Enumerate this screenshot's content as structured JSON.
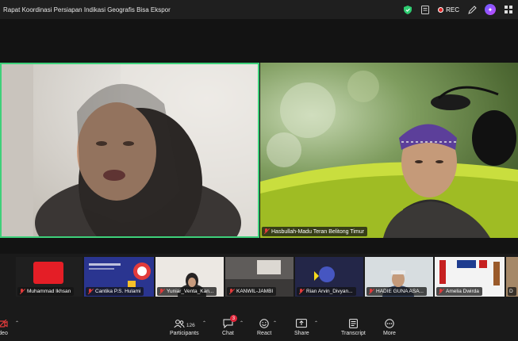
{
  "window": {
    "title": "Rapat Koordinasi Persiapan Indikasi Geografis Bisa Ekspor",
    "rec_label": "REC"
  },
  "main_tiles": [
    {
      "participant": ""
    },
    {
      "participant": "Hasbullah-Madu Teran Belitong Timur"
    }
  ],
  "thumbnails": [
    {
      "name": ""
    },
    {
      "name": "Muhammad Ikhsan"
    },
    {
      "name": "Cantika P.S. Hulami"
    },
    {
      "name": "Yuniar_Venta_Kan..."
    },
    {
      "name": "KANWIL-JAMBI"
    },
    {
      "name": "Rian Arvin_Divyan..."
    },
    {
      "name": "HADIE GUNA ASA..."
    },
    {
      "name": "Amelia Dwirda"
    },
    {
      "name": "D"
    }
  ],
  "toolbar": {
    "video_label": "deo",
    "participants_label": "Participants",
    "participants_count": "126",
    "chat_label": "Chat",
    "chat_badge": "3",
    "react_label": "React",
    "share_label": "Share",
    "transcript_label": "Transcript",
    "more_label": "More"
  },
  "colors": {
    "active_speaker_border": "#3ed07a",
    "rec_dot": "#e02828",
    "badge": "#e0263a"
  }
}
